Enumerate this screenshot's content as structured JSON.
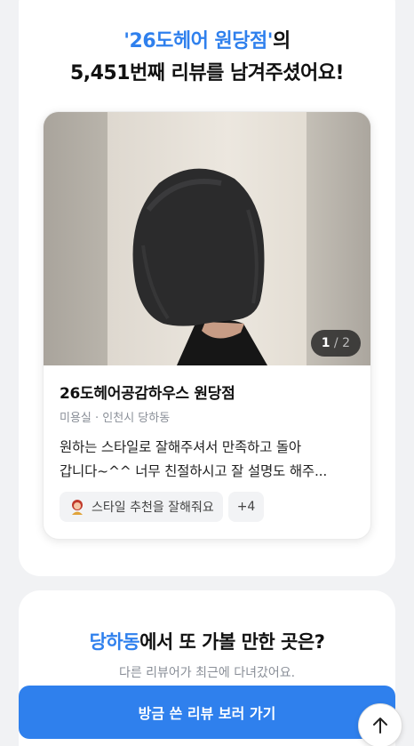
{
  "headline": {
    "shop_quoted": "'26도헤어 원당점'",
    "shop_suffix": "의",
    "line2": "5,451번째 리뷰를 남겨주셨어요!"
  },
  "review_card": {
    "photo_counter": {
      "current": "1",
      "separator": " / ",
      "total": "2"
    },
    "shop_name": "26도헤어공감하우스 원당점",
    "category": "미용실",
    "meta_sep": " · ",
    "location": "인천시 당하동",
    "review_line1": "원하는 스타일로 잘해주셔서 만족하고 돌아",
    "review_line2": "갑니다~^^ 너무 친절하시고 잘 설명도 해주...",
    "tags": [
      {
        "icon": "stylist-emoji-icon",
        "label": "스타일 추천을 잘해줘요"
      },
      {
        "label": "+4"
      }
    ]
  },
  "nearby": {
    "title_accent": "당하동",
    "title_rest": "에서 또 가볼 만한 곳은?",
    "subtitle": "다른 리뷰어가 최근에 다녀갔어요."
  },
  "cta_label": "방금 쓴 리뷰 보러 가기",
  "scroll_top_icon": "arrow-up-icon",
  "colors": {
    "accent": "#2f80ed",
    "cta_bg": "#2f80ed"
  }
}
